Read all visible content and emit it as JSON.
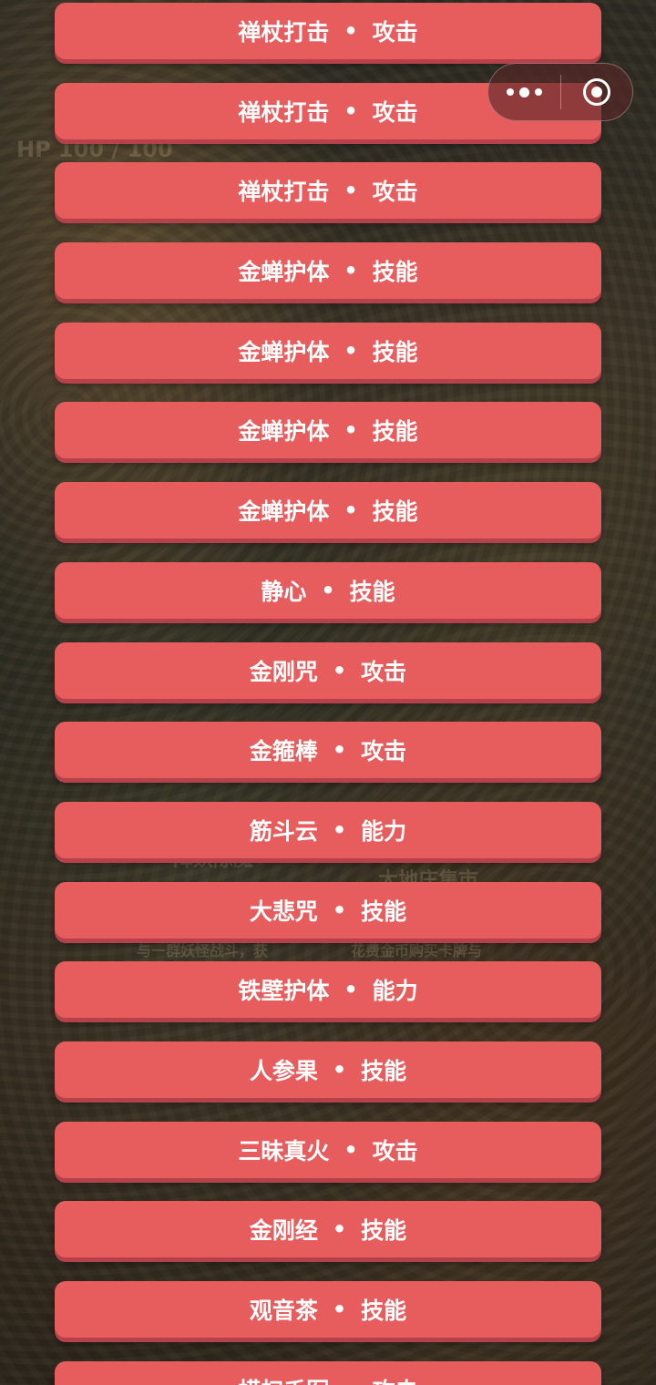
{
  "background_ghost_text": {
    "hp": "HP 100 / 100",
    "option_a": "降妖除魔",
    "option_b": "大地庄集市",
    "option_c": "与一群妖怪战斗，获",
    "option_d": "花费金币购买卡牌与"
  },
  "actions": [
    {
      "name": "禅杖打击",
      "type": "攻击"
    },
    {
      "name": "禅杖打击",
      "type": "攻击"
    },
    {
      "name": "禅杖打击",
      "type": "攻击"
    },
    {
      "name": "金蝉护体",
      "type": "技能"
    },
    {
      "name": "金蝉护体",
      "type": "技能"
    },
    {
      "name": "金蝉护体",
      "type": "技能"
    },
    {
      "name": "金蝉护体",
      "type": "技能"
    },
    {
      "name": "静心",
      "type": "技能"
    },
    {
      "name": "金刚咒",
      "type": "攻击"
    },
    {
      "name": "金箍棒",
      "type": "攻击"
    },
    {
      "name": "筋斗云",
      "type": "能力"
    },
    {
      "name": "大悲咒",
      "type": "技能"
    },
    {
      "name": "铁壁护体",
      "type": "能力"
    },
    {
      "name": "人参果",
      "type": "技能"
    },
    {
      "name": "三昧真火",
      "type": "攻击"
    },
    {
      "name": "金刚经",
      "type": "技能"
    },
    {
      "name": "观音茶",
      "type": "技能"
    },
    {
      "name": "横扫千军",
      "type": "攻击"
    }
  ],
  "separator": "•",
  "capsule": {
    "more_icon": "more-dots-icon",
    "close_icon": "close-target-icon"
  },
  "colors": {
    "button": "#e75d5e",
    "button_shadow": "#b5414a",
    "text": "#ffffff"
  }
}
